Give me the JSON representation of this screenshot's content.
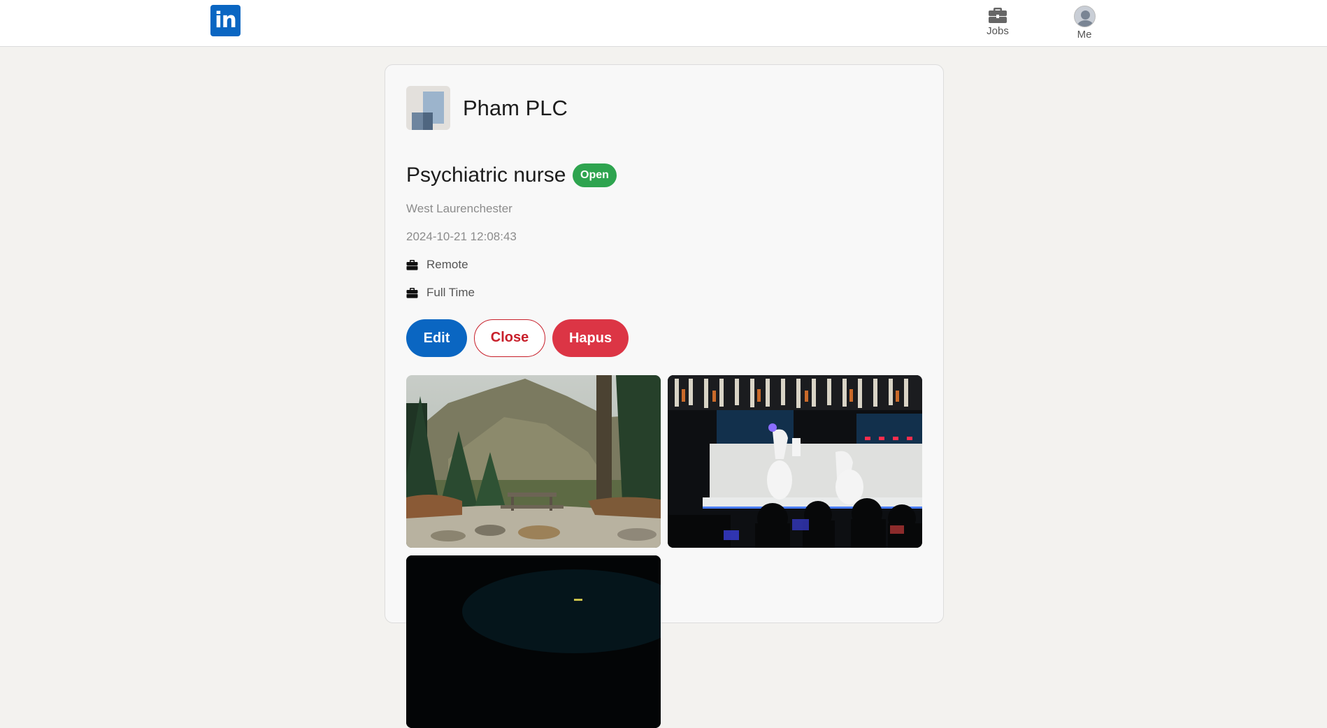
{
  "nav": {
    "logo_text": "in",
    "items": [
      {
        "label": "Jobs",
        "icon": "briefcase-icon"
      },
      {
        "label": "Me",
        "icon": "avatar-icon"
      }
    ]
  },
  "job": {
    "company": "Pham PLC",
    "title": "Psychiatric nurse",
    "status": "Open",
    "location": "West Laurenchester",
    "posted_at": "2024-10-21 12:08:43",
    "workplace_type": "Remote",
    "employment_type": "Full Time"
  },
  "actions": {
    "edit_label": "Edit",
    "close_label": "Close",
    "delete_label": "Hapus"
  },
  "photos": [
    {
      "subject": "mountain forest with picnic table"
    },
    {
      "subject": "robot arms at a drink bar"
    },
    {
      "subject": "dark scene"
    }
  ],
  "colors": {
    "brand": "#0a66c2",
    "status_open": "#2ea44f",
    "danger": "#dc3545",
    "page_bg": "#f3f2ef"
  }
}
